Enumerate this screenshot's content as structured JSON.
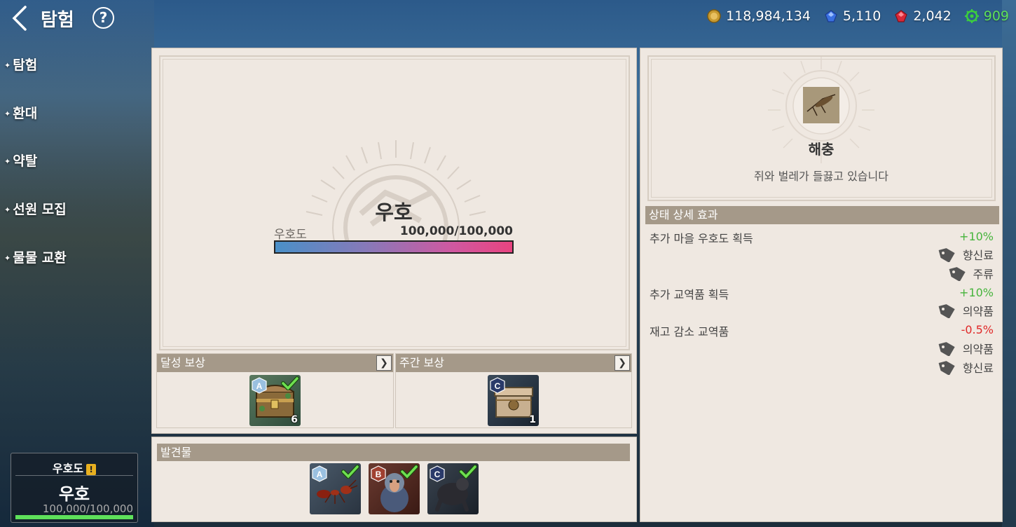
{
  "header": {
    "title": "탐험",
    "help_glyph": "?",
    "currencies": [
      {
        "icon": "gold-coin-icon",
        "value": "118,984,134"
      },
      {
        "icon": "blue-gem-icon",
        "value": "5,110"
      },
      {
        "icon": "red-gem-icon",
        "value": "2,042"
      },
      {
        "icon": "green-helm-icon",
        "value": "909"
      }
    ]
  },
  "nav": {
    "items": [
      {
        "label": "탐험"
      },
      {
        "label": "환대"
      },
      {
        "label": "약탈"
      },
      {
        "label": "선원 모집"
      },
      {
        "label": "물물 교환"
      }
    ]
  },
  "status_box": {
    "title": "우호도",
    "warning": "!",
    "value": "우호",
    "progress": "100,000/100,000",
    "fill_fraction": 1.0
  },
  "relation": {
    "name": "우호",
    "label": "우호도",
    "progress": "100,000/100,000",
    "fill_fraction": 1.0
  },
  "rewards": {
    "achievement": {
      "label": "달성 보상",
      "arrow": "❯",
      "item": {
        "tier": "A",
        "count": "6",
        "checked": true
      }
    },
    "weekly": {
      "label": "주간 보상",
      "arrow": "❯",
      "item": {
        "tier": "C",
        "count": "1",
        "checked": false
      }
    }
  },
  "discoveries": {
    "label": "발견물",
    "items": [
      {
        "tier": "A",
        "checked": true,
        "subject": "ant"
      },
      {
        "tier": "B",
        "checked": true,
        "subject": "monkey"
      },
      {
        "tier": "C",
        "checked": true,
        "subject": "gorilla"
      }
    ]
  },
  "state": {
    "name": "해충",
    "description": "쥐와 벌레가 들끓고 있습니다",
    "detail_header": "상태 상세 효과",
    "effects": [
      {
        "label": "추가 마을 우호도 획득",
        "value": "+10%",
        "sign": "pos",
        "tags": [
          "향신료",
          "주류"
        ]
      },
      {
        "label": "추가 교역품 획득",
        "value": "+10%",
        "sign": "pos",
        "tags": [
          "의약품"
        ]
      },
      {
        "label": "재고 감소 교역품",
        "value": "-0.5%",
        "sign": "neg",
        "tags": [
          "의약품",
          "향신료"
        ]
      }
    ]
  },
  "colors": {
    "positive": "#46b43c",
    "negative": "#e02828",
    "panel_bg": "#efe8e1",
    "header_bar": "#a59989",
    "currency_green": "#5ee05a"
  }
}
